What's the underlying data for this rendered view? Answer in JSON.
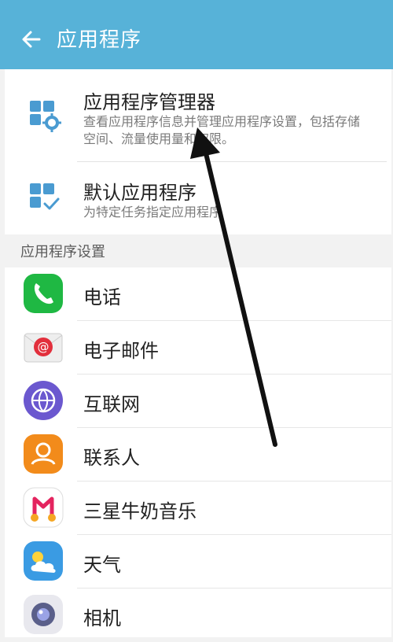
{
  "header": {
    "title": "应用程序",
    "back_icon": "arrow-left-icon"
  },
  "top_items": [
    {
      "title": "应用程序管理器",
      "desc": "查看应用程序信息并管理应用程序设置，包括存储空间、流量使用量和权限。",
      "icon": "app-manager-icon"
    },
    {
      "title": "默认应用程序",
      "desc": "为特定任务指定应用程序",
      "icon": "default-apps-icon"
    }
  ],
  "section_title": "应用程序设置",
  "apps": [
    {
      "label": "电话",
      "icon": "phone-icon"
    },
    {
      "label": "电子邮件",
      "icon": "email-icon"
    },
    {
      "label": "互联网",
      "icon": "internet-icon"
    },
    {
      "label": "联系人",
      "icon": "contacts-icon"
    },
    {
      "label": "三星牛奶音乐",
      "icon": "music-icon"
    },
    {
      "label": "天气",
      "icon": "weather-icon"
    },
    {
      "label": "相机",
      "icon": "camera-icon"
    }
  ],
  "colors": {
    "header": "#57b2d8",
    "icon_blue": "#4a9bd1",
    "phone": "#1fb843",
    "email": "#e22f3c",
    "internet": "#6b58cf",
    "contacts": "#f28b1b"
  }
}
